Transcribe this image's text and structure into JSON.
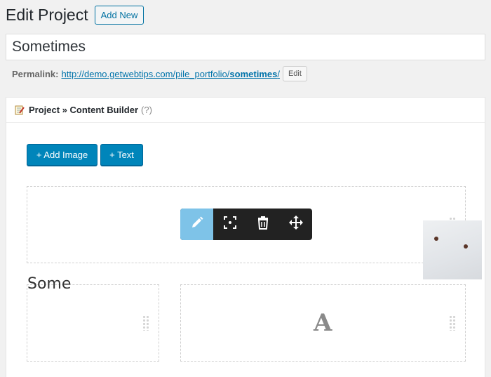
{
  "header": {
    "title": "Edit Project",
    "add_new_label": "Add New"
  },
  "post": {
    "title_value": "Sometimes"
  },
  "permalink": {
    "label": "Permalink:",
    "url_base": "http://demo.getwebtips.com/pile_portfolio/",
    "url_slug": "sometimes",
    "url_trailing": "/",
    "edit_label": "Edit"
  },
  "metabox": {
    "icon": "memo-icon",
    "title": "Project » Content Builder",
    "help": "(?)"
  },
  "builder": {
    "add_image_label": "+ Add Image",
    "add_text_label": "+ Text",
    "toolbar": [
      {
        "icon": "pencil-icon",
        "active": true
      },
      {
        "icon": "focus-icon",
        "active": false
      },
      {
        "icon": "trash-icon",
        "active": false
      },
      {
        "icon": "move-icon",
        "active": false
      }
    ],
    "text_block_content": "Some",
    "text_placeholder_glyph": "A"
  },
  "colors": {
    "primary": "#0085ba",
    "toolbar_bg": "#222222",
    "toolbar_active": "#7ec3e8"
  }
}
